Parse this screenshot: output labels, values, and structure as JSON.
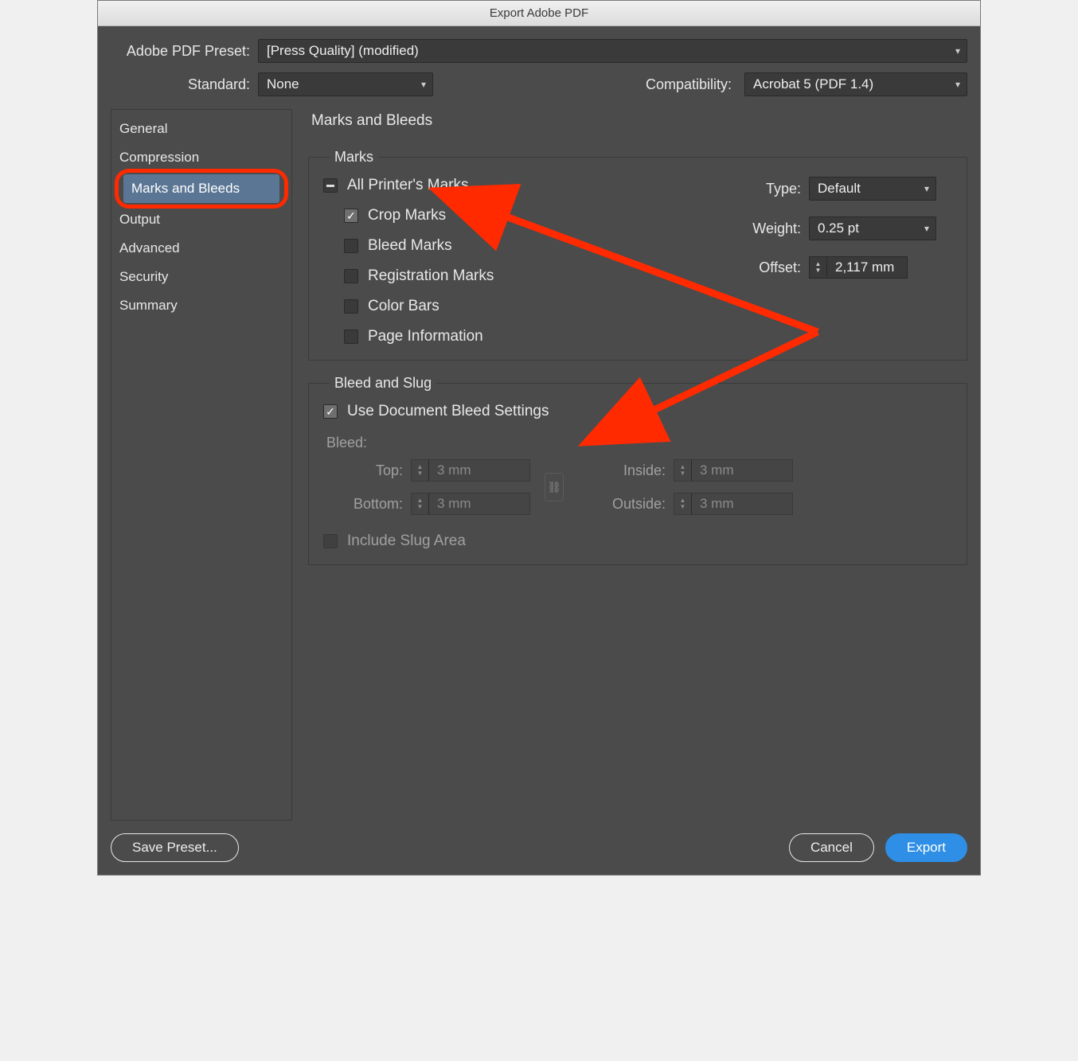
{
  "title": "Export Adobe PDF",
  "labels": {
    "preset": "Adobe PDF Preset:",
    "standard": "Standard:",
    "compatibility": "Compatibility:"
  },
  "preset": "[Press Quality] (modified)",
  "standard": "None",
  "compatibility": "Acrobat 5 (PDF 1.4)",
  "sidebar": [
    "General",
    "Compression",
    "Marks and Bleeds",
    "Output",
    "Advanced",
    "Security",
    "Summary"
  ],
  "sidebar_selected_index": 2,
  "content_title": "Marks and Bleeds",
  "marks": {
    "legend": "Marks",
    "all_printers_marks": "All Printer's Marks",
    "crop_marks": "Crop Marks",
    "bleed_marks": "Bleed Marks",
    "registration_marks": "Registration Marks",
    "color_bars": "Color Bars",
    "page_information": "Page Information",
    "type_label": "Type:",
    "type_value": "Default",
    "weight_label": "Weight:",
    "weight_value": "0.25 pt",
    "offset_label": "Offset:",
    "offset_value": "2,117 mm"
  },
  "bleed": {
    "legend": "Bleed and Slug",
    "use_doc": "Use Document Bleed Settings",
    "heading": "Bleed:",
    "top_label": "Top:",
    "bottom_label": "Bottom:",
    "inside_label": "Inside:",
    "outside_label": "Outside:",
    "top": "3 mm",
    "bottom": "3 mm",
    "inside": "3 mm",
    "outside": "3 mm",
    "include_slug": "Include Slug Area"
  },
  "buttons": {
    "save_preset": "Save Preset...",
    "cancel": "Cancel",
    "export": "Export"
  }
}
